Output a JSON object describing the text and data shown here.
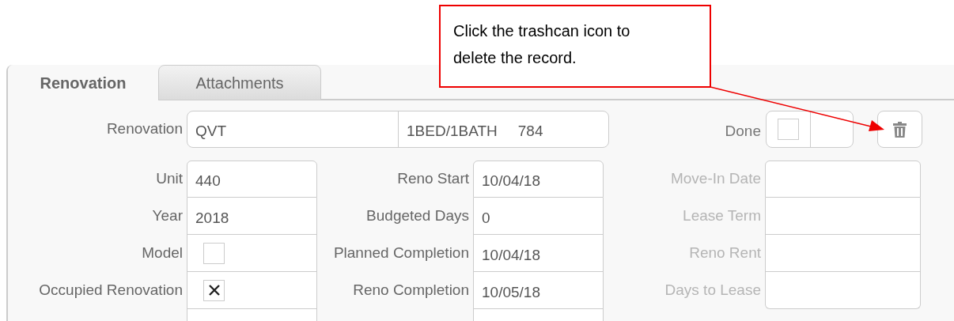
{
  "callout": {
    "text": "Click the trashcan icon to delete the record."
  },
  "tabs": [
    {
      "label": "Renovation",
      "selected": true
    },
    {
      "label": "Attachments",
      "selected": false
    }
  ],
  "renovation": {
    "label": "Renovation",
    "code": "QVT",
    "floorplan": "1BED/1BATH",
    "sqft": "784"
  },
  "done": {
    "label": "Done",
    "checked": false
  },
  "columns": [
    [
      {
        "label": "Unit",
        "kind": "text",
        "value": "440",
        "disabled": false
      },
      {
        "label": "Year",
        "kind": "text",
        "value": "2018",
        "disabled": false
      },
      {
        "label": "Model",
        "kind": "checkbox",
        "checked": false,
        "disabled": false
      },
      {
        "label": "Occupied Renovation",
        "kind": "checkbox",
        "checked": true,
        "disabled": false
      }
    ],
    [
      {
        "label": "Reno Start",
        "kind": "text",
        "value": "10/04/18",
        "disabled": false
      },
      {
        "label": "Budgeted Days",
        "kind": "text",
        "value": "0",
        "disabled": false
      },
      {
        "label": "Planned Completion",
        "kind": "text",
        "value": "10/04/18",
        "disabled": false
      },
      {
        "label": "Reno Completion",
        "kind": "text",
        "value": "10/05/18",
        "disabled": false
      }
    ],
    [
      {
        "label": "Move-In Date",
        "kind": "text",
        "disabled": true
      },
      {
        "label": "Lease Term",
        "kind": "text",
        "disabled": true
      },
      {
        "label": "Reno Rent",
        "kind": "text",
        "disabled": true
      },
      {
        "label": "Days to Lease",
        "kind": "text",
        "disabled": true
      }
    ]
  ]
}
